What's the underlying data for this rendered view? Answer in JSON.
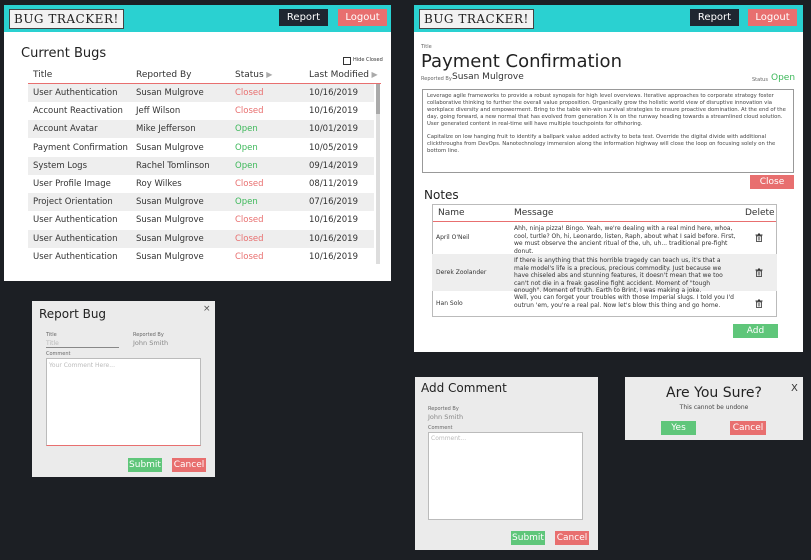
{
  "brand": {
    "logo_text": "BUG TRACKER!"
  },
  "header": {
    "report_label": "Report",
    "logout_label": "Logout"
  },
  "bugs": {
    "title": "Current Bugs",
    "hide_closed_label": "Hide Closed",
    "columns": [
      "Title",
      "Reported By",
      "Status",
      "Last Modified"
    ],
    "rows": [
      {
        "title": "User Authentication",
        "reporter": "Susan Mulgrove",
        "status": "Closed",
        "modified": "10/16/2019"
      },
      {
        "title": "Account Reactivation",
        "reporter": "Jeff Wilson",
        "status": "Closed",
        "modified": "10/16/2019"
      },
      {
        "title": "Account Avatar",
        "reporter": "Mike Jefferson",
        "status": "Open",
        "modified": "10/01/2019"
      },
      {
        "title": "Payment Confirmation",
        "reporter": "Susan Mulgrove",
        "status": "Open",
        "modified": "10/05/2019"
      },
      {
        "title": "System Logs",
        "reporter": "Rachel Tomlinson",
        "status": "Open",
        "modified": "09/14/2019"
      },
      {
        "title": "User Profile Image",
        "reporter": "Roy Wilkes",
        "status": "Closed",
        "modified": "08/11/2019"
      },
      {
        "title": "Project Orientation",
        "reporter": "Susan Mulgrove",
        "status": "Open",
        "modified": "07/16/2019"
      },
      {
        "title": "User Authentication",
        "reporter": "Susan Mulgrove",
        "status": "Closed",
        "modified": "10/16/2019"
      },
      {
        "title": "User Authentication",
        "reporter": "Susan Mulgrove",
        "status": "Closed",
        "modified": "10/16/2019"
      },
      {
        "title": "User Authentication",
        "reporter": "Susan Mulgrove",
        "status": "Closed",
        "modified": "10/16/2019"
      }
    ]
  },
  "detail": {
    "title_label": "Title",
    "title": "Payment Confirmation",
    "reported_by_label": "Reported By",
    "reporter": "Susan Mulgrove",
    "status_label": "Status",
    "status": "Open",
    "description_p1": "Leverage agile frameworks to provide a robust synopsis for high level overviews. Iterative approaches to corporate strategy foster collaborative thinking to further the overall value proposition. Organically grow the holistic world view of disruptive innovation via workplace diversity and empowerment. Bring to the table win-win survival strategies to ensure proactive domination. At the end of the day, going forward, a new normal that has evolved from generation X is on the runway heading towards a streamlined cloud solution. User generated content in real-time will have multiple touchpoints for offshoring.",
    "description_p2": "Capitalize on low hanging fruit to identify a ballpark value added activity to beta test. Override the digital divide with additional clickthroughs from DevOps. Nanotechnology immersion along the information highway will close the loop on focusing solely on the bottom line.",
    "close_label": "Close",
    "notes_title": "Notes",
    "notes_columns": [
      "Name",
      "Message",
      "Delete"
    ],
    "notes": [
      {
        "author": "April O'Neil",
        "message": "Ahh, ninja pizza! Bingo. Yeah, we're dealing with a real mind here, whoa, cool, turtle? Oh, hi, Leonardo, listen, Raph, about what I said before. First, we must observe the ancient ritual of the, uh, uh... traditional pre-fight donut."
      },
      {
        "author": "Derek Zoolander",
        "message": "If there is anything that this horrible tragedy can teach us, it's that a male model's life is a precious, precious commodity. Just because we have chiseled abs and stunning features, it doesn't mean that we too can't not die in a freak gasoline fight accident. Moment of \"tough enough\". Moment of truth. Earth to Brint, I was making a joke."
      },
      {
        "author": "Han Solo",
        "message": "Well, you can forget your troubles with those Imperial slugs. I told you I'd outrun 'em, you're a real pal. Now let's blow this thing and go home."
      }
    ],
    "add_label": "Add"
  },
  "report_modal": {
    "title": "Report Bug",
    "title_field_label": "Title",
    "title_placeholder": "Title",
    "reported_by_label": "Reported By",
    "reporter": "John Smith",
    "comment_label": "Comment",
    "comment_placeholder": "Your Comment Here...",
    "submit_label": "Submit",
    "cancel_label": "Cancel",
    "close_glyph": "×"
  },
  "comment_modal": {
    "title": "Add Comment",
    "reported_by_label": "Reported By",
    "reporter": "John Smith",
    "comment_label": "Comment",
    "comment_placeholder": "Comment...",
    "submit_label": "Submit",
    "cancel_label": "Cancel"
  },
  "confirm_modal": {
    "title": "Are You Sure?",
    "subtitle": "This cannot be undone",
    "yes_label": "Yes",
    "cancel_label": "Cancel",
    "close_glyph": "X"
  },
  "colors": {
    "accent": "#2ad1d1",
    "danger": "#e86f6f",
    "success": "#5fc67a",
    "dark": "#1f2630",
    "background": "#1c1f24"
  }
}
